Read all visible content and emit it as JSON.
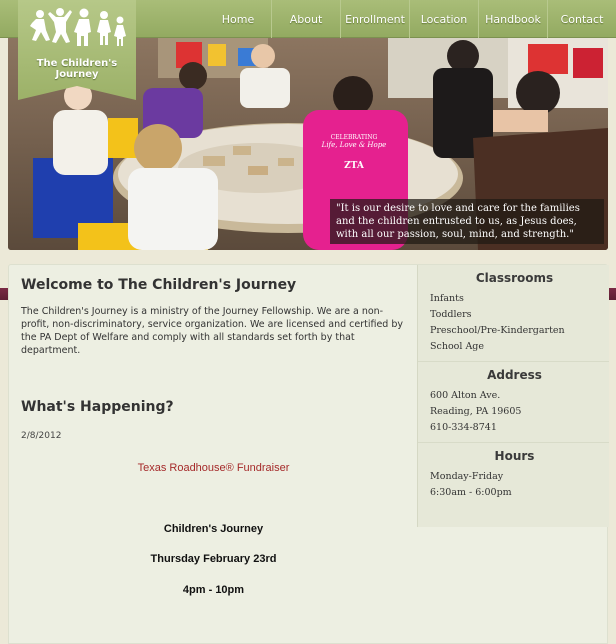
{
  "logo": {
    "name": "The Children's Journey"
  },
  "nav": [
    {
      "label": "Home"
    },
    {
      "label": "About"
    },
    {
      "label": "Enrollment"
    },
    {
      "label": "Location"
    },
    {
      "label": "Handbook"
    },
    {
      "label": "Contact"
    }
  ],
  "hero": {
    "quote": "\"It is our desire to love and care for the families and the children entrusted to us, as Jesus does, with all our passion, soul, mind, and strength.\"",
    "shirt_text": [
      "CELEBRATING",
      "Life, Love & Hope",
      "ZTA"
    ]
  },
  "main": {
    "welcome_title": "Welcome to The Children's Journey",
    "welcome_text": "The Children's Journey is a ministry of the Journey Fellowship. We are a non-profit, non-discriminatory, service organization. We are licensed and certified by the PA Dept of Welfare and comply with all standards set forth by that department.",
    "happening_title": "What's Happening?",
    "date": "2/8/2012",
    "event_link": "Texas Roadhouse®  Fundraiser",
    "event_lines": [
      "Children's Journey",
      "Thursday February 23rd",
      "4pm - 10pm"
    ]
  },
  "sidebar": {
    "classrooms": {
      "title": "Classrooms",
      "items": [
        "Infants",
        "Toddlers",
        "Preschool/Pre-Kindergarten",
        "School Age"
      ]
    },
    "address": {
      "title": "Address",
      "lines": [
        "600 Alton Ave.",
        "Reading, PA 19605",
        "610-334-8741"
      ]
    },
    "hours": {
      "title": "Hours",
      "lines": [
        "Monday-Friday",
        "6:30am - 6:00pm"
      ]
    }
  },
  "colors": {
    "nav_green": "#9cb168",
    "accent_maroon": "#6b2439",
    "link_red": "#a52a2a",
    "panel_bg": "#edefe2"
  }
}
